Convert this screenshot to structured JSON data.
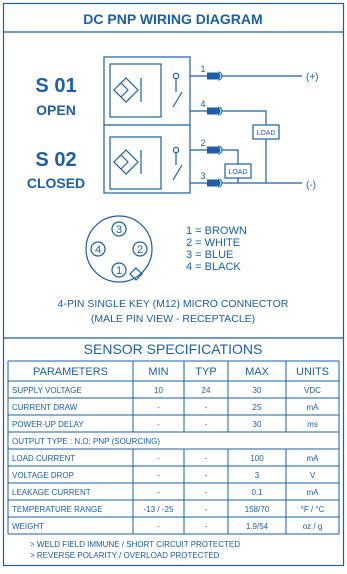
{
  "header": {
    "title": "DC PNP WIRING DIAGRAM"
  },
  "sensors": [
    {
      "id": "S 01",
      "state": "OPEN"
    },
    {
      "id": "S 02",
      "state": "CLOSED"
    }
  ],
  "pins": {
    "s01_top": "1",
    "s01_bottom": "4",
    "s02_top": "2",
    "s02_bottom": "3"
  },
  "terminals": {
    "positive": "(+)",
    "negative": "(-)"
  },
  "loads": {
    "load_1": "LOAD",
    "load_2": "LOAD"
  },
  "connector": {
    "pin_numbers": [
      "3",
      "4",
      "2",
      "1"
    ],
    "legend": [
      "1 = BROWN",
      "2 = WHITE",
      "3 = BLUE",
      "4 = BLACK"
    ],
    "caption_1": "4-PIN SINGLE KEY (M12) MICRO CONNECTOR",
    "caption_2": "(MALE PIN VIEW - RECEPTACLE)"
  },
  "specs": {
    "title": "SENSOR SPECIFICATIONS",
    "headers": [
      "PARAMETERS",
      "MIN",
      "TYP",
      "MAX",
      "UNITS"
    ],
    "rows": [
      [
        "SUPPLY VOLTAGE",
        "10",
        "24",
        "30",
        "VDC"
      ],
      [
        "CURRENT DRAW",
        "-",
        "-",
        "25",
        "mA"
      ],
      [
        "POWER-UP DELAY",
        "-",
        "-",
        "30",
        "ms"
      ],
      [
        "OUTPUT TYPE : N.O; PNP (SOURCING)"
      ],
      [
        "LOAD CURRENT",
        "-",
        "-",
        "100",
        "mA"
      ],
      [
        "VOLTAGE DROP",
        "-",
        "-",
        "3",
        "V"
      ],
      [
        "LEAKAGE CURRENT",
        "-",
        "-",
        "0.1",
        "mA"
      ],
      [
        "TEMPERATURE RANGE",
        "-13 / -25",
        "-",
        "158/70",
        "°F / °C"
      ],
      [
        "WEIGHT",
        "-",
        "-",
        "1.9/54",
        "oz / g"
      ]
    ],
    "notes": [
      "> WELD FIELD IMMUNE / SHORT CIRCUIT PROTECTED",
      "> REVERSE POLARITY / OVERLOAD PROTECTED"
    ]
  },
  "colors": {
    "line": "#1a5fa8",
    "background": "#ffffff"
  }
}
